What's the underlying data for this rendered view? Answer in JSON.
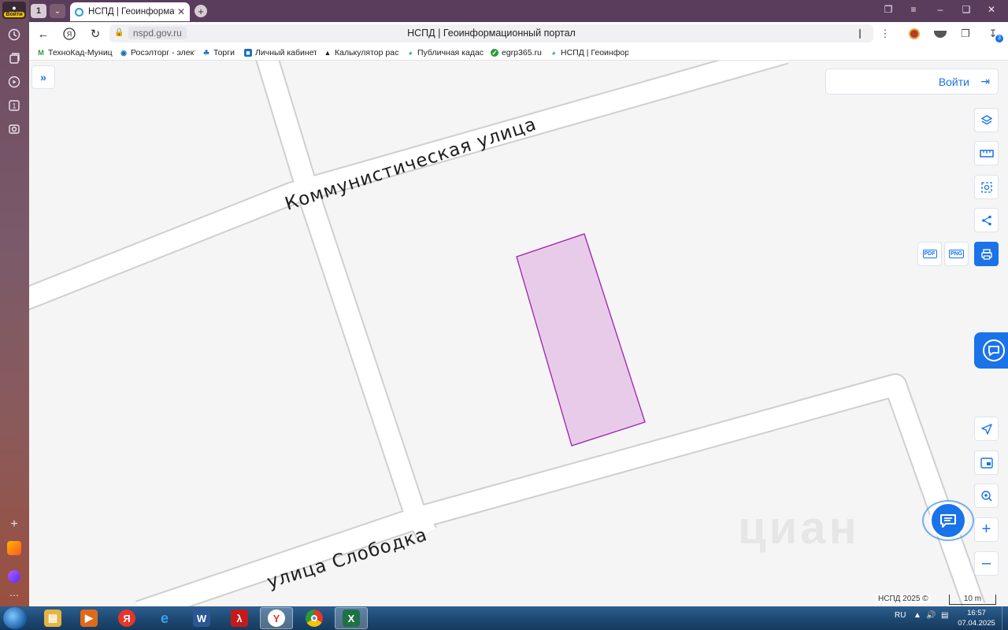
{
  "sidebar": {
    "login_label": "Войти"
  },
  "tabs": {
    "count": "1",
    "active_title": "НСПД | Геоинформаци"
  },
  "toolbar": {
    "url": "nspd.gov.ru",
    "page_title": "НСПД | Геоинформационный портал",
    "downloads_badge": "3"
  },
  "bookmarks": [
    {
      "label": "ТехноКад-Муниц",
      "icon": "technokad-icon"
    },
    {
      "label": "Росэлторг - элект",
      "icon": "roseltorg-icon"
    },
    {
      "label": "Торги",
      "icon": "torgi-icon"
    },
    {
      "label": "Личный кабинет",
      "icon": "cabinet-icon"
    },
    {
      "label": "Калькулятор рас",
      "icon": "calculator-icon"
    },
    {
      "label": "Публичная кадас",
      "icon": "cadastral-icon"
    },
    {
      "label": "egrp365.ru",
      "icon": "egrp-icon"
    },
    {
      "label": "НСПД | Геоинфор",
      "icon": "nspd-icon"
    }
  ],
  "map": {
    "login_label": "Войти",
    "streets": [
      "Коммунистическая улица",
      "улица Слободка"
    ],
    "parcel_fill": "#e8cbe8",
    "parcel_stroke": "#a020b0",
    "attribution": "НСПД 2025 ©",
    "scale_label": "10 m",
    "watermark": "циан",
    "accent": "#1a73e8"
  },
  "taskbar": {
    "lang": "RU",
    "time": "16:57",
    "date": "07.04.2025"
  }
}
